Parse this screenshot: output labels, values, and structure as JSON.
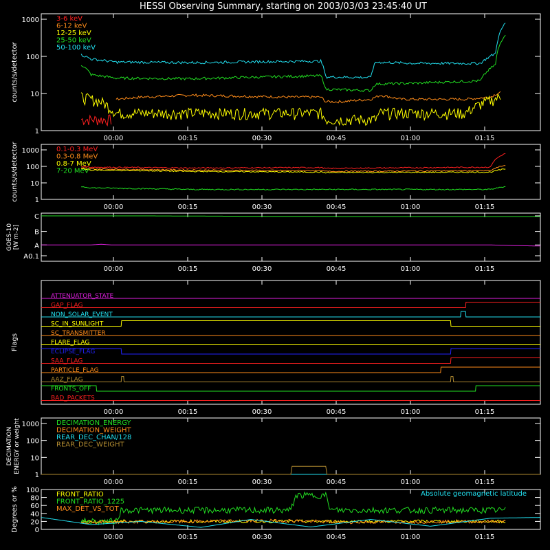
{
  "title": "HESSI Observing Summary, starting on 2003/03/03 23:45:40 UT",
  "x_ticks": [
    "00:00",
    "00:15",
    "00:30",
    "00:45",
    "01:00",
    "01:15"
  ],
  "colors": {
    "red": "#ff2020",
    "orange": "#ff8c1a",
    "yellow": "#ffff00",
    "green": "#22e022",
    "cyan": "#22e0f0",
    "magenta": "#e020e0",
    "blue": "#2222ff",
    "olive": "#b08a30",
    "white": "#ffffff"
  },
  "chart_data": [
    {
      "type": "line",
      "ylabel": "counts/s/detector",
      "yscale": "log",
      "ylim": [
        1,
        1000
      ],
      "y_ticks": [
        "1",
        "10",
        "100",
        "1000"
      ],
      "x_ticks": [
        "00:00",
        "00:15",
        "00:30",
        "00:45",
        "01:00",
        "01:15"
      ],
      "legend": "top-left",
      "series": [
        {
          "name": "3-6 keV",
          "color": "#ff2020",
          "x": [
            0.08,
            0.1,
            0.12,
            0.14
          ],
          "y": [
            2,
            2,
            2,
            2
          ]
        },
        {
          "name": "6-12 keV",
          "color": "#ff8c1a",
          "x": [
            0.15,
            0.2,
            0.3,
            0.4,
            0.5,
            0.56,
            0.57,
            0.6,
            0.66,
            0.68,
            0.72,
            0.76,
            0.8,
            0.85,
            0.9,
            0.92
          ],
          "y": [
            7,
            8,
            9,
            8.5,
            8,
            8,
            6,
            6,
            7,
            9,
            7,
            7,
            7,
            7,
            8,
            11
          ]
        },
        {
          "name": "12-25 keV",
          "color": "#ffff00",
          "x": [
            0.08,
            0.12,
            0.15,
            0.3,
            0.5,
            0.56,
            0.57,
            0.67,
            0.68,
            0.85,
            0.92
          ],
          "y": [
            8,
            6,
            3,
            3,
            3,
            3,
            2,
            2,
            3,
            3,
            8
          ]
        },
        {
          "name": "25-50 keV",
          "color": "#22e022",
          "x": [
            0.08,
            0.1,
            0.15,
            0.3,
            0.45,
            0.56,
            0.57,
            0.66,
            0.67,
            0.75,
            0.88,
            0.91,
            0.93
          ],
          "y": [
            60,
            32,
            26,
            25,
            28,
            30,
            13,
            12,
            18,
            19,
            22,
            60,
            400
          ]
        },
        {
          "name": "50-100 keV",
          "color": "#22e0f0",
          "x": [
            0.08,
            0.1,
            0.15,
            0.3,
            0.45,
            0.56,
            0.57,
            0.66,
            0.67,
            0.75,
            0.88,
            0.91,
            0.93
          ],
          "y": [
            110,
            85,
            70,
            68,
            72,
            75,
            28,
            27,
            70,
            65,
            65,
            120,
            800
          ]
        }
      ]
    },
    {
      "type": "line",
      "ylabel": "counts/s/detector",
      "yscale": "log",
      "ylim": [
        1,
        1000
      ],
      "y_ticks": [
        "1",
        "10",
        "100",
        "1000"
      ],
      "x_ticks": [
        "00:00",
        "00:15",
        "00:30",
        "00:45",
        "01:00",
        "01:15"
      ],
      "legend": "top-left",
      "series": [
        {
          "name": "0.1-0.3 MeV",
          "color": "#ff2020",
          "x": [
            0.08,
            0.1,
            0.3,
            0.56,
            0.57,
            0.9,
            0.93
          ],
          "y": [
            100,
            90,
            80,
            85,
            75,
            90,
            600
          ]
        },
        {
          "name": "0.3-0.8 MeV",
          "color": "#ff8c1a",
          "x": [
            0.08,
            0.1,
            0.3,
            0.56,
            0.57,
            0.9,
            0.93
          ],
          "y": [
            80,
            70,
            60,
            55,
            50,
            55,
            120
          ]
        },
        {
          "name": "0.8-7 MeV",
          "color": "#ffff00",
          "x": [
            0.08,
            0.1,
            0.3,
            0.56,
            0.57,
            0.9,
            0.93
          ],
          "y": [
            70,
            60,
            50,
            45,
            42,
            45,
            70
          ]
        },
        {
          "name": "7-20 MeV",
          "color": "#22e022",
          "x": [
            0.08,
            0.1,
            0.3,
            0.56,
            0.57,
            0.9,
            0.93
          ],
          "y": [
            6,
            5,
            4,
            4,
            4,
            4,
            6
          ]
        }
      ]
    },
    {
      "type": "line",
      "ylabel": "GOES-10 [W m-2]",
      "y_ticks": [
        "A0.1",
        "A",
        "B",
        "C"
      ],
      "x_ticks": [
        "00:00",
        "00:15",
        "00:30",
        "00:45",
        "01:00",
        "01:15"
      ],
      "series": [
        {
          "name": "",
          "color": "#22e022",
          "x": [
            0,
            0.2,
            0.4,
            0.6,
            0.8,
            1.0
          ],
          "y": [
            2.95,
            2.95,
            2.92,
            2.9,
            2.9,
            2.9
          ]
        },
        {
          "name": "",
          "color": "#e020e0",
          "x": [
            0,
            0.1,
            0.12,
            0.14,
            0.5,
            0.9,
            0.95,
            1.0
          ],
          "y": [
            0.8,
            0.8,
            0.85,
            0.8,
            0.8,
            0.8,
            0.75,
            0.72
          ]
        }
      ]
    },
    {
      "type": "line",
      "ylabel": "Flags",
      "series": [
        {
          "name": "ATTENUATOR_STATE",
          "color": "#e020e0",
          "x": [
            0,
            1
          ],
          "y": [
            0,
            0
          ]
        },
        {
          "name": "GAP_FLAG",
          "color": "#ff2020",
          "x": [
            0,
            0.85,
            0.851,
            1
          ],
          "y": [
            0,
            0,
            1,
            1
          ]
        },
        {
          "name": "NON_SOLAR_EVENT",
          "color": "#22e0f0",
          "x": [
            0,
            0.84,
            0.841,
            0.85,
            0.851,
            1
          ],
          "y": [
            0,
            0,
            1,
            1,
            0,
            0
          ]
        },
        {
          "name": "SC_IN_SUNLIGHT",
          "color": "#ffff00",
          "x": [
            0,
            0.16,
            0.161,
            0.82,
            0.821,
            1
          ],
          "y": [
            0,
            0,
            1,
            1,
            0,
            0
          ]
        },
        {
          "name": "SC_TRANSMITTER",
          "color": "#ff8c1a",
          "x": [
            0,
            1
          ],
          "y": [
            0,
            0
          ]
        },
        {
          "name": "FLARE_FLAG",
          "color": "#ffff00",
          "x": [
            0,
            1
          ],
          "y": [
            0,
            0
          ]
        },
        {
          "name": "ECLIPSE_FLAG",
          "color": "#2222ff",
          "x": [
            0,
            0.16,
            0.161,
            0.82,
            0.821,
            1
          ],
          "y": [
            1,
            1,
            0,
            0,
            1,
            1
          ]
        },
        {
          "name": "SAA_FLAG",
          "color": "#ff2020",
          "x": [
            0,
            0.82,
            0.821,
            1
          ],
          "y": [
            0,
            0,
            1,
            1
          ]
        },
        {
          "name": "PARTICLE_FLAG",
          "color": "#ff8c1a",
          "x": [
            0,
            0.8,
            0.801,
            1
          ],
          "y": [
            0,
            0,
            1,
            1
          ]
        },
        {
          "name": "AAZ_FLAG",
          "color": "#b08a30",
          "x": [
            0,
            0.16,
            0.161,
            0.165,
            0.166,
            0.82,
            0.821,
            0.825,
            0.826,
            1
          ],
          "y": [
            0,
            0,
            1,
            1,
            0,
            0,
            1,
            1,
            0,
            0
          ]
        },
        {
          "name": "FRONTS_OFF",
          "color": "#22e022",
          "x": [
            0,
            0.11,
            0.111,
            0.87,
            0.871,
            1
          ],
          "y": [
            1,
            1,
            0,
            0,
            1,
            1
          ]
        },
        {
          "name": "BAD_PACKETS",
          "color": "#ff2020",
          "x": [
            0,
            1
          ],
          "y": [
            0,
            0
          ]
        }
      ]
    },
    {
      "type": "line",
      "ylabel": "DECIMATION ENERGY or weight",
      "yscale": "log",
      "y_ticks": [
        "1",
        "10",
        "100",
        "1000"
      ],
      "x_ticks": [
        "00:00",
        "00:15",
        "00:30",
        "00:45",
        "01:00",
        "01:15"
      ],
      "series": [
        {
          "name": "DECIMATION_ENERGY",
          "color": "#22e022",
          "x": [
            0,
            1
          ],
          "y": [
            1,
            1
          ]
        },
        {
          "name": "DECIMATION_WEIGHT",
          "color": "#ff8c1a",
          "x": [
            0,
            1
          ],
          "y": [
            1,
            1
          ]
        },
        {
          "name": "REAR_DEC_CHAN/128",
          "color": "#22e0f0",
          "x": [
            0,
            1
          ],
          "y": [
            1,
            1
          ]
        },
        {
          "name": "REAR_DEC_WEIGHT",
          "color": "#b08a30",
          "x": [
            0,
            0.5,
            0.501,
            0.57,
            0.571,
            1
          ],
          "y": [
            1,
            1,
            3,
            3,
            1,
            1
          ]
        }
      ]
    },
    {
      "type": "line",
      "ylabel": "Degrees or %",
      "ylim": [
        0,
        100
      ],
      "y_ticks": [
        "0",
        "20",
        "40",
        "60",
        "80",
        "100"
      ],
      "x_ticks": [
        "00:00",
        "00:15",
        "00:30",
        "00:45",
        "01:00",
        "01:15"
      ],
      "annotations": [
        "Absolute geomagnetic latitude"
      ],
      "series": [
        {
          "name": "FRONT_RATIO",
          "color": "#ffff00",
          "x": [
            0.08,
            0.15,
            0.93
          ],
          "y": [
            20,
            20,
            20
          ]
        },
        {
          "name": "FRONT_RATIO_1225",
          "color": "#22e022",
          "x": [
            0.08,
            0.15,
            0.16,
            0.5,
            0.51,
            0.57,
            0.58,
            0.93
          ],
          "y": [
            20,
            20,
            48,
            48,
            85,
            85,
            48,
            48
          ]
        },
        {
          "name": "MAX_DET_VS_TOT",
          "color": "#ff8c1a",
          "x": [
            0.08,
            0.3,
            0.5,
            0.6,
            0.93
          ],
          "y": [
            18,
            20,
            22,
            18,
            20
          ]
        },
        {
          "name": "",
          "color": "#22e0f0",
          "x": [
            0,
            0.1,
            0.2,
            0.32,
            0.42,
            0.54,
            0.66,
            0.78,
            0.9,
            1.0
          ],
          "y": [
            30,
            12,
            20,
            5,
            25,
            6,
            25,
            8,
            28,
            30
          ]
        }
      ]
    }
  ]
}
